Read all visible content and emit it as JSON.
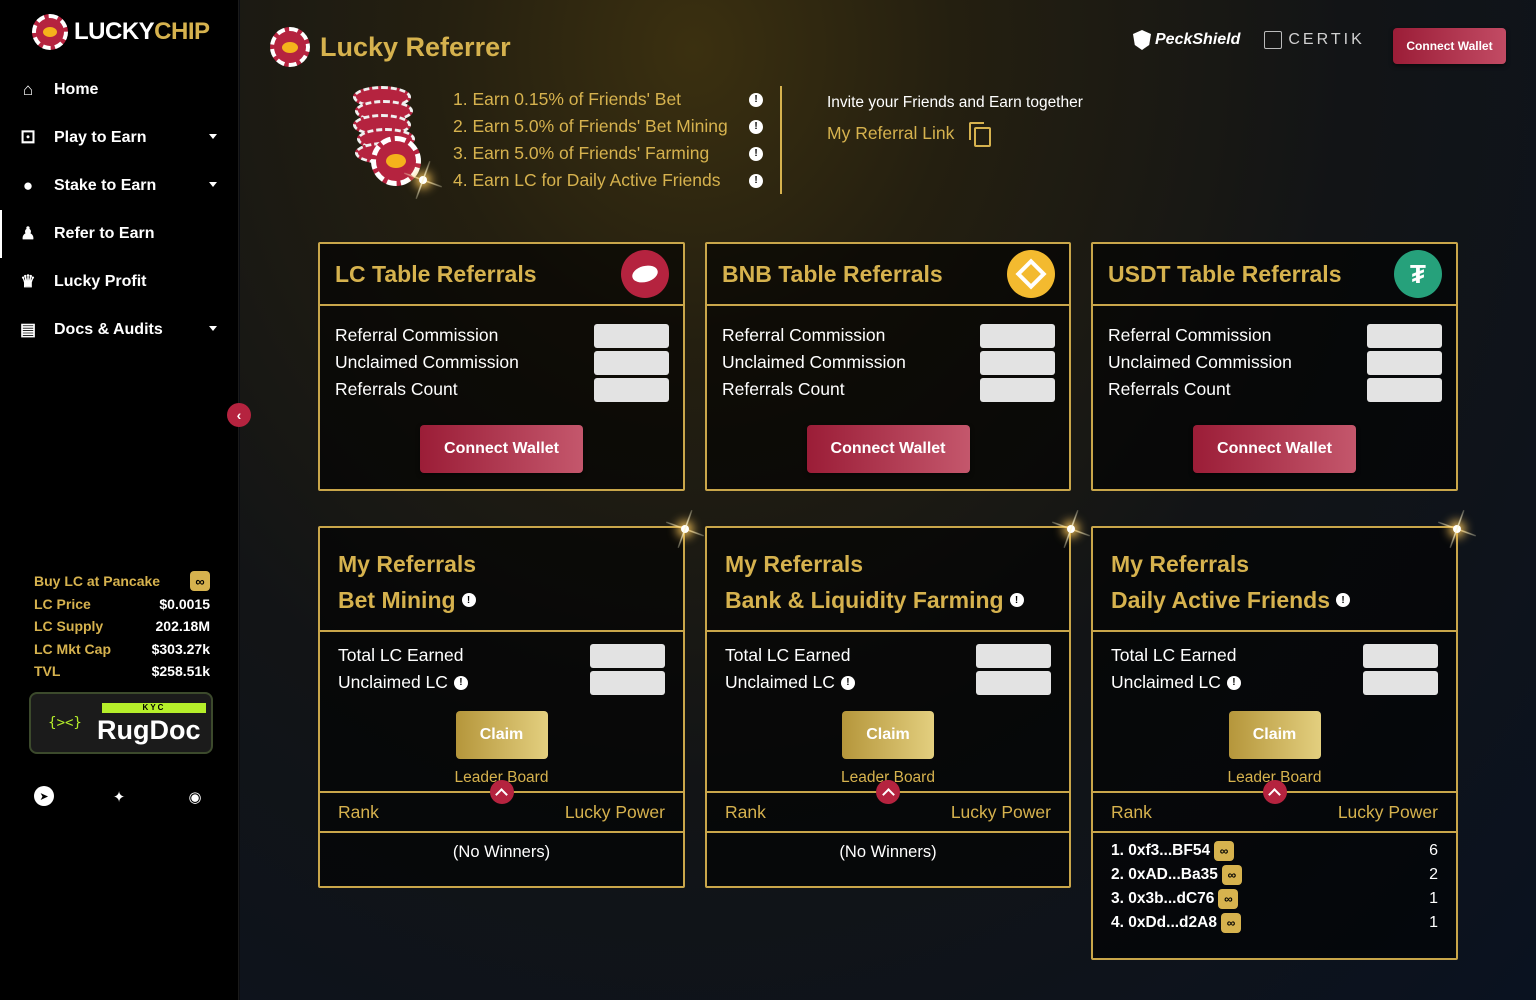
{
  "brand": {
    "lucky": "LUCKY",
    "chip": "CHIP"
  },
  "nav": [
    {
      "label": "Home",
      "icon": "home-icon"
    },
    {
      "label": "Play to Earn",
      "icon": "dice-icon"
    },
    {
      "label": "Stake to Earn",
      "icon": "coins-icon"
    },
    {
      "label": "Refer to Earn",
      "icon": "person-icon"
    },
    {
      "label": "Lucky Profit",
      "icon": "trophy-icon"
    },
    {
      "label": "Docs & Audits",
      "icon": "document-search-icon"
    }
  ],
  "stats": {
    "buy_label": "Buy LC at Pancake",
    "price_label": "LC Price",
    "price": "$0.0015",
    "supply_label": "LC Supply",
    "supply": "202.18M",
    "mktcap_label": "LC Mkt Cap",
    "mktcap": "$303.27k",
    "tvl_label": "TVL",
    "tvl": "$258.51k"
  },
  "rugdoc": {
    "kyc": "KYC",
    "name": "RugDoc"
  },
  "header": {
    "title": "Lucky Referrer",
    "peckshield": "PeckShield",
    "certik": "CERTIK",
    "connect_wallet": "Connect Wallet"
  },
  "earn_items": [
    "1. Earn 0.15% of Friends' Bet",
    "2. Earn 5.0% of Friends' Bet Mining",
    "3. Earn 5.0% of Friends' Farming",
    "4. Earn LC for Daily Active Friends"
  ],
  "invite_text": "Invite your Friends and Earn together",
  "referral_link_label": "My Referral Link",
  "table_cards": [
    {
      "title": "LC Table Referrals",
      "token": "lc-token-icon"
    },
    {
      "title": "BNB Table Referrals",
      "token": "bnb-token-icon"
    },
    {
      "title": "USDT Table Referrals",
      "token": "usdt-token-icon"
    }
  ],
  "table_labels": {
    "commission": "Referral Commission",
    "unclaimed": "Unclaimed Commission",
    "count": "Referrals Count",
    "connect": "Connect Wallet"
  },
  "referral_cards": [
    {
      "line1": "My Referrals",
      "line2": "Bet Mining"
    },
    {
      "line1": "My Referrals",
      "line2": "Bank & Liquidity Farming"
    },
    {
      "line1": "My Referrals",
      "line2": "Daily Active Friends"
    }
  ],
  "referral_labels": {
    "total": "Total LC Earned",
    "unclaimed": "Unclaimed LC",
    "claim": "Claim",
    "leaderboard": "Leader Board",
    "rank": "Rank",
    "power": "Lucky Power",
    "no_winners": "(No Winners)"
  },
  "leaderboard_daily": [
    {
      "addr": "1. 0xf3...BF54",
      "score": "6"
    },
    {
      "addr": "2. 0xAD...Ba35",
      "score": "2"
    },
    {
      "addr": "3. 0x3b...dC76",
      "score": "1"
    },
    {
      "addr": "4. 0xDd...d2A8",
      "score": "1"
    }
  ],
  "colors": {
    "gold": "#d6b24e",
    "red": "#b5233f",
    "bnb": "#f3ba2f",
    "usdt": "#26a17b"
  }
}
